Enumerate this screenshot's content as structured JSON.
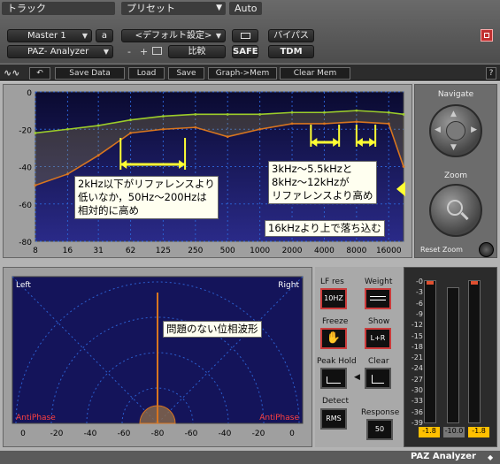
{
  "host": {
    "track_header": "トラック",
    "preset_header": "プリセット",
    "auto_header": "Auto",
    "track_name": "Master 1",
    "track_letter": "a",
    "plugin_name": "PAZ- Analyzer",
    "preset_name": "<デフォルト設定>",
    "minus": "-",
    "plus": "+",
    "compare": "比較",
    "safe": "SAFE",
    "bypass": "バイパス",
    "tdm": "TDM"
  },
  "toolbar": {
    "save_data": "Save Data",
    "load": "Load",
    "save": "Save",
    "graph_mem": "Graph->Mem",
    "clear_mem": "Clear Mem",
    "help": "?"
  },
  "graph": {
    "y_ticks": [
      "0",
      "-20",
      "-40",
      "-60",
      "-80"
    ],
    "x_ticks": [
      "8",
      "16",
      "31",
      "62",
      "125",
      "250",
      "500",
      "1000",
      "2000",
      "4000",
      "8000",
      "16000"
    ]
  },
  "nav": {
    "navigate": "Navigate",
    "zoom": "Zoom",
    "reset_zoom": "Reset Zoom"
  },
  "annotations": {
    "low": "2kHz以下がリファレンスより\n低いなか，50Hz～200Hzは\n相対的に高め",
    "mid": "3kHz～5.5kHzと\n8kHz～12kHzが\nリファレンスより高め",
    "high": "16kHzより上で落ち込む",
    "phase": "問題のない位相波形"
  },
  "phase": {
    "left": "Left",
    "right": "Right",
    "anti_l": "AntiPhase",
    "anti_r": "AntiPhase",
    "x_ticks": [
      "0",
      "-20",
      "-40",
      "-60",
      "-80",
      "-60",
      "-40",
      "-20",
      "0"
    ]
  },
  "controls": {
    "lf_res": "LF res",
    "weight": "Weight",
    "lf_value": "10HZ",
    "freeze": "Freeze",
    "show": "Show",
    "show_value": "L+R",
    "peak_hold": "Peak Hold",
    "clear": "Clear",
    "detect": "Detect",
    "response": "Response",
    "detect_value": "RMS",
    "response_value": "50"
  },
  "meter": {
    "scale": [
      "-0",
      "-3",
      "-6",
      "-9",
      "-12",
      "-15",
      "-18",
      "-21",
      "-24",
      "-27",
      "-30",
      "-33",
      "-36",
      "-39"
    ],
    "peak_left": "-1.8",
    "peak_mid": "-10.0",
    "peak_right": "-1.8"
  },
  "bottom": {
    "title": "PAZ Analyzer"
  },
  "chart_data": {
    "type": "line",
    "xlabel": "",
    "ylabel": "",
    "x": [
      8,
      16,
      31,
      62,
      125,
      250,
      500,
      1000,
      2000,
      4000,
      8000,
      16000,
      22000
    ],
    "ylim": [
      -80,
      0
    ],
    "series": [
      {
        "values": [
          -22,
          -20,
          -18,
          -15,
          -13,
          -12,
          -12,
          -12,
          -11,
          -11,
          -10,
          -11,
          -12
        ],
        "color": "#9ccc2a"
      },
      {
        "values": [
          -50,
          -44,
          -34,
          -22,
          -20,
          -19,
          -24,
          -20,
          -17,
          -17,
          -16,
          -17,
          -40
        ],
        "color": "#d8751f"
      }
    ]
  },
  "colors": {
    "green_trace": "#9ccc2a",
    "orange_trace": "#d8751f",
    "annotation_arrow": "#ffff33",
    "plot_bg": "#101050",
    "active_border": "#cc3b3b"
  }
}
